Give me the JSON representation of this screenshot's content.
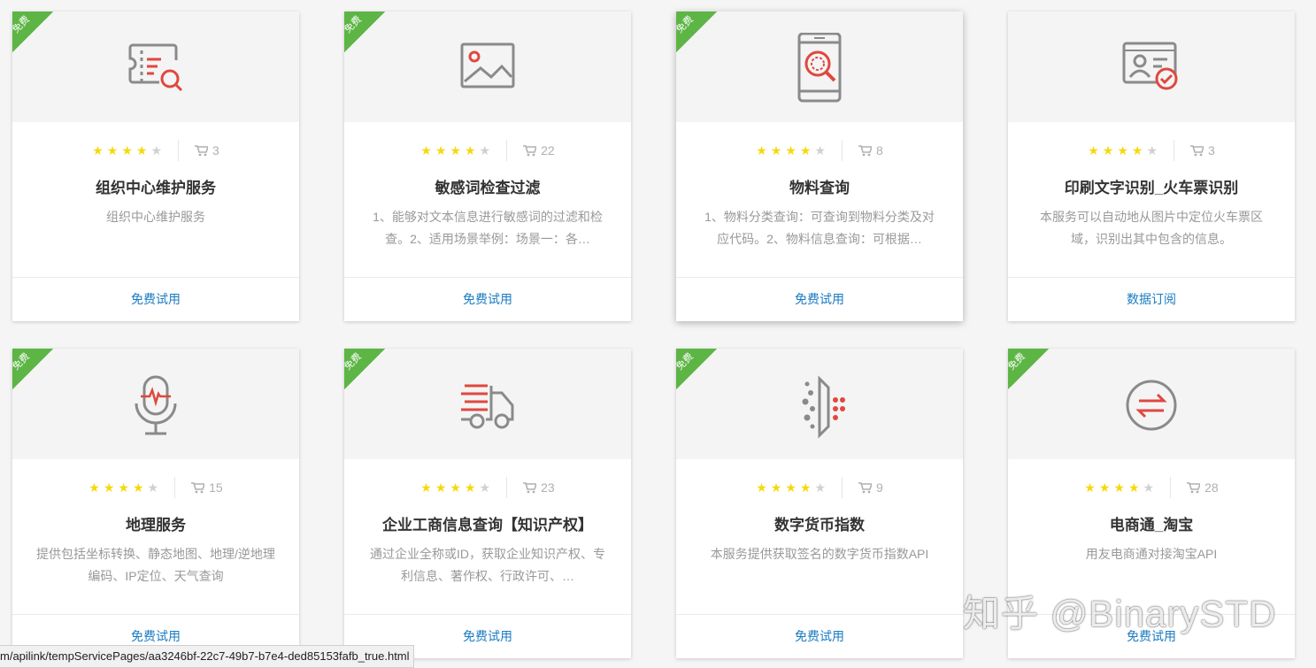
{
  "badge_label": "免费",
  "colors": {
    "ribbon": "#5cb544",
    "star_on": "#f5d90c",
    "star_off": "#d0d0d0",
    "link": "#1a7bc2",
    "icon_gray": "#8a8a8a",
    "icon_red": "#e0483e"
  },
  "cards": [
    {
      "icon": "ticket-search-icon",
      "rating": 4,
      "count": "3",
      "title": "组织中心维护服务",
      "desc": "组织中心维护服务",
      "action": "免费试用"
    },
    {
      "icon": "image-icon",
      "rating": 4,
      "count": "22",
      "title": "敏感词检查过滤",
      "desc": "1、能够对文本信息进行敏感词的过滤和检查。2、适用场景举例：场景一：各…",
      "action": "免费试用"
    },
    {
      "icon": "phone-search-icon",
      "rating": 4,
      "count": "8",
      "title": "物料查询",
      "desc": "1、物料分类查询：可查询到物料分类及对应代码。2、物料信息查询：可根据…",
      "action": "免费试用"
    },
    {
      "icon": "id-card-check-icon",
      "rating": 4,
      "count": "3",
      "title": "印刷文字识别_火车票识别",
      "desc": "本服务可以自动地从图片中定位火车票区域，识别出其中包含的信息。",
      "action": "数据订阅"
    },
    {
      "icon": "microphone-icon",
      "rating": 4,
      "count": "15",
      "title": "地理服务",
      "desc": "提供包括坐标转换、静态地图、地理/逆地理编码、IP定位、天气查询",
      "action": "免费试用"
    },
    {
      "icon": "delivery-truck-icon",
      "rating": 4,
      "count": "23",
      "title": "企业工商信息查询【知识产权】",
      "desc": "通过企业全称或ID，获取企业知识产权、专利信息、著作权、行政许可、…",
      "action": "免费试用"
    },
    {
      "icon": "digital-dots-icon",
      "rating": 4,
      "count": "9",
      "title": "数字货币指数",
      "desc": "本服务提供获取签名的数字货币指数API",
      "action": "免费试用"
    },
    {
      "icon": "exchange-arrows-icon",
      "rating": 4,
      "count": "28",
      "title": "电商通_淘宝",
      "desc": "用友电商通对接淘宝API",
      "action": "免费试用"
    }
  ],
  "status_url": "m/apilink/tempServicePages/aa3246bf-22c7-49b7-b7e4-ded85153fafb_true.html",
  "watermark": "知乎 @BinarySTD"
}
